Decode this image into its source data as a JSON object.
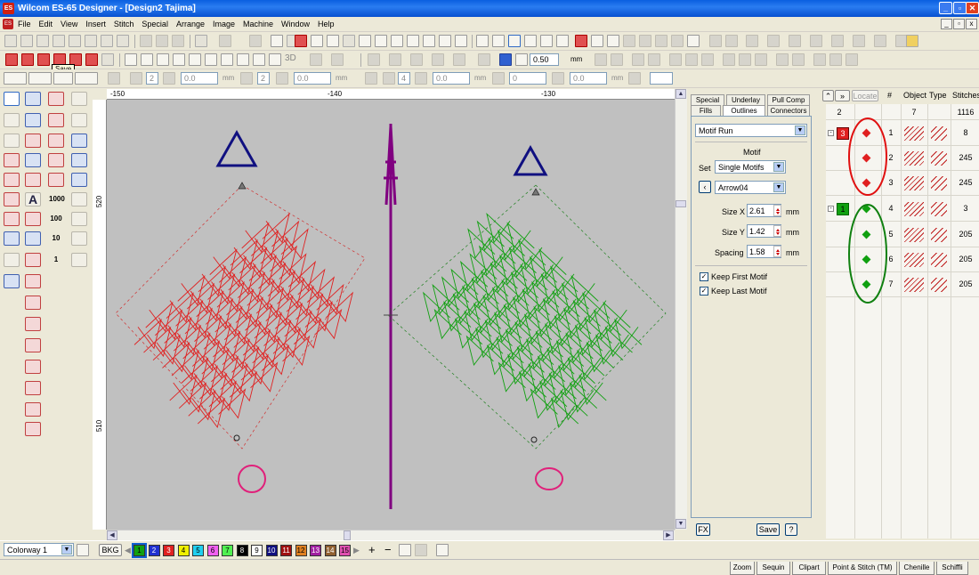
{
  "title": "Wilcom ES-65 Designer - [Design2          Tajima]",
  "app_icon": "ES",
  "menu": [
    "File",
    "Edit",
    "View",
    "Insert",
    "Stitch",
    "Special",
    "Arrange",
    "Image",
    "Machine",
    "Window",
    "Help"
  ],
  "toolbar": {
    "stitch_length": "0.50",
    "unit": "mm",
    "save_tooltip": "Save",
    "preset_3d": "3D"
  },
  "disabled_fields": {
    "v1": "2",
    "v2": "0.0",
    "v3": "2",
    "v4": "0.0",
    "v5": "4",
    "v6": "0.0",
    "v7": "0",
    "v8": "0.0",
    "unit": "mm"
  },
  "left_tools": {
    "n1": "1000",
    "n2": "100",
    "n3": "10",
    "n4": "1"
  },
  "rulers": {
    "h": [
      "-150",
      "-140",
      "-130"
    ],
    "v": [
      "520",
      "510"
    ]
  },
  "properties": {
    "tabs_row1": [
      "Special",
      "Underlay",
      "Pull Comp"
    ],
    "tabs_row2": [
      "Fills",
      "Outlines",
      "Connectors"
    ],
    "type": "Motif Run",
    "section": "Motif",
    "set_label": "Set",
    "set_value": "Single Motifs",
    "motif": "Arrow04",
    "size_x_label": "Size X",
    "size_x": "2.61",
    "size_y_label": "Size Y",
    "size_y": "1.42",
    "spacing_label": "Spacing",
    "spacing": "1.58",
    "unit": "mm",
    "keep_first": "Keep First Motif",
    "keep_last": "Keep Last Motif",
    "fx": "FX",
    "save": "Save",
    "help": "?"
  },
  "sequence": {
    "locate": "Locate",
    "headers": [
      "#",
      "Object",
      "Type",
      "Stitches"
    ],
    "summary": {
      "colors": "2",
      "objects": "7",
      "stitches": "1116"
    },
    "groups": [
      {
        "badge": "3",
        "color": "#e02020"
      },
      {
        "badge": "1",
        "color": "#10a010"
      }
    ],
    "rows": [
      {
        "num": "1",
        "stitches": "8"
      },
      {
        "num": "2",
        "stitches": "245"
      },
      {
        "num": "3",
        "stitches": "245"
      },
      {
        "num": "4",
        "stitches": "3"
      },
      {
        "num": "5",
        "stitches": "205"
      },
      {
        "num": "6",
        "stitches": "205"
      },
      {
        "num": "7",
        "stitches": "205"
      }
    ]
  },
  "colorway": "Colorway 1",
  "bkg": "BKG",
  "palette": [
    {
      "n": "1",
      "c": "#10a010"
    },
    {
      "n": "2",
      "c": "#2030d0"
    },
    {
      "n": "3",
      "c": "#e02020"
    },
    {
      "n": "4",
      "c": "#f0f000"
    },
    {
      "n": "5",
      "c": "#20d0f0"
    },
    {
      "n": "6",
      "c": "#f060f0"
    },
    {
      "n": "7",
      "c": "#50f050"
    },
    {
      "n": "8",
      "c": "#000000"
    },
    {
      "n": "9",
      "c": "#ffffff"
    },
    {
      "n": "10",
      "c": "#101080"
    },
    {
      "n": "11",
      "c": "#a01010"
    },
    {
      "n": "12",
      "c": "#e08020"
    },
    {
      "n": "13",
      "c": "#a020a0"
    },
    {
      "n": "14",
      "c": "#906030"
    },
    {
      "n": "15",
      "c": "#e050b0"
    }
  ],
  "status_tabs": [
    "Zoom",
    "Sequin",
    "Clipart",
    "Point & Stitch (TM)",
    "Chenille",
    "Schiffli"
  ]
}
